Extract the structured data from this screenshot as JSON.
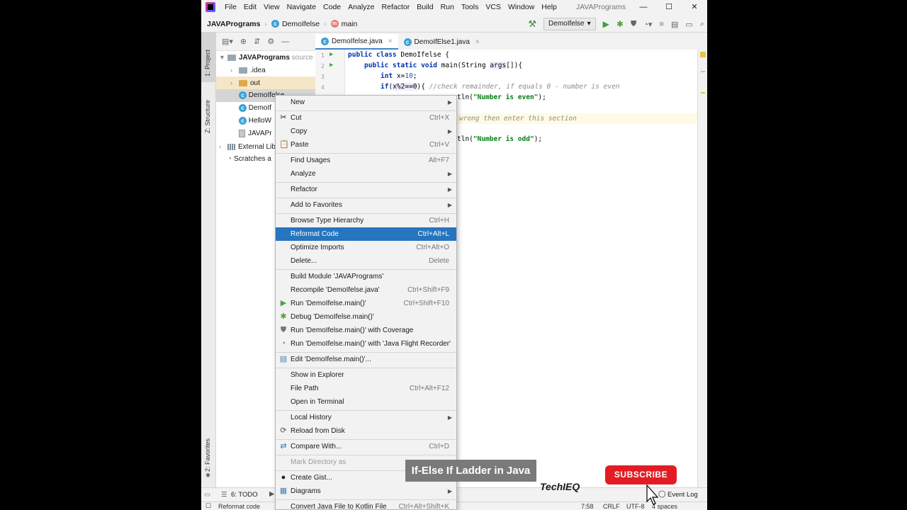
{
  "menubar": {
    "items": [
      "File",
      "Edit",
      "View",
      "Navigate",
      "Code",
      "Analyze",
      "Refactor",
      "Build",
      "Run",
      "Tools",
      "VCS",
      "Window",
      "Help"
    ],
    "title": "JAVAPrograms"
  },
  "navbar": {
    "project": "JAVAPrograms",
    "class": "DemoIfelse",
    "method": "main",
    "run_config": "DemoIfelse"
  },
  "left_tabs": {
    "project": "1: Project",
    "structure": "Z: Structure",
    "favorites": "2: Favorites"
  },
  "tree": {
    "root": "JAVAPrograms",
    "root_suffix": "source",
    "idea": ".idea",
    "out": "out",
    "file1": "DemoIfelse",
    "file2": "DemoIf",
    "file3": "HelloW",
    "file4": "JAVAPr",
    "ext": "External Lib",
    "scratches": "Scratches a"
  },
  "editor_tabs": [
    "DemoIfelse.java",
    "DemoIfElse1.java"
  ],
  "code": {
    "line1_kw": "public class",
    "line1_rest": " DemoIfelse {",
    "line2_kw": "public static void",
    "line2_rest": " main(String ",
    "line2_param": "args",
    "line2_end": "[]){",
    "line3_kw": "int",
    "line3_rest": " x=",
    "line3_num": "10",
    "line3_end": ";",
    "line4_kw": "if",
    "line4_cond": "(",
    "line4_hl": "x%2==0",
    "line4_end": "){ ",
    "line4_comment": "//check remainder, if equals 0 - number is even",
    "line5_rest": "tln(",
    "line5_str": "\"Number is even\"",
    "line5_end": ");",
    "line7_comment": "wrong then enter this section",
    "line9_rest": "tln(",
    "line9_str": "\"Number is odd\"",
    "line9_end": ");"
  },
  "gutter_numbers": [
    "1",
    "2",
    "3",
    "4"
  ],
  "context_menu": {
    "new": "New",
    "cut": "Cut",
    "cut_sc": "Ctrl+X",
    "copy": "Copy",
    "paste": "Paste",
    "paste_sc": "Ctrl+V",
    "find_usages": "Find Usages",
    "find_usages_sc": "Alt+F7",
    "analyze": "Analyze",
    "refactor": "Refactor",
    "add_fav": "Add to Favorites",
    "browse_type": "Browse Type Hierarchy",
    "browse_type_sc": "Ctrl+H",
    "reformat": "Reformat Code",
    "reformat_sc": "Ctrl+Alt+L",
    "optimize": "Optimize Imports",
    "optimize_sc": "Ctrl+Alt+O",
    "delete": "Delete...",
    "delete_sc": "Delete",
    "build_module": "Build Module 'JAVAPrograms'",
    "recompile": "Recompile 'DemoIfelse.java'",
    "recompile_sc": "Ctrl+Shift+F9",
    "run": "Run 'DemoIfelse.main()'",
    "run_sc": "Ctrl+Shift+F10",
    "debug": "Debug 'DemoIfelse.main()'",
    "run_cov": "Run 'DemoIfelse.main()' with Coverage",
    "run_jfr": "Run 'DemoIfelse.main()' with 'Java Flight Recorder'",
    "edit_cfg": "Edit 'DemoIfelse.main()'...",
    "show_explorer": "Show in Explorer",
    "file_path": "File Path",
    "file_path_sc": "Ctrl+Alt+F12",
    "open_terminal": "Open in Terminal",
    "local_history": "Local History",
    "reload": "Reload from Disk",
    "compare": "Compare With...",
    "compare_sc": "Ctrl+D",
    "mark_dir": "Mark Directory as",
    "gist": "Create Gist...",
    "diagrams": "Diagrams",
    "convert": "Convert Java File to Kotlin File",
    "convert_sc": "Ctrl+Alt+Shift+K"
  },
  "bottom": {
    "todo": "6: TODO",
    "event_log": "Event Log"
  },
  "status": {
    "left": "Reformat code",
    "pos": "7:58",
    "crlf": "CRLF",
    "enc": "UTF-8",
    "indent": "4 spaces"
  },
  "overlay": {
    "caption": "If-Else If Ladder in Java",
    "brand": "TechIEQ",
    "subscribe": "SUBSCRIBE"
  },
  "colors": {
    "menu_highlight": "#2675bf",
    "subscribe_red": "#e31c23",
    "caption_bg": "#7a7a7a"
  }
}
